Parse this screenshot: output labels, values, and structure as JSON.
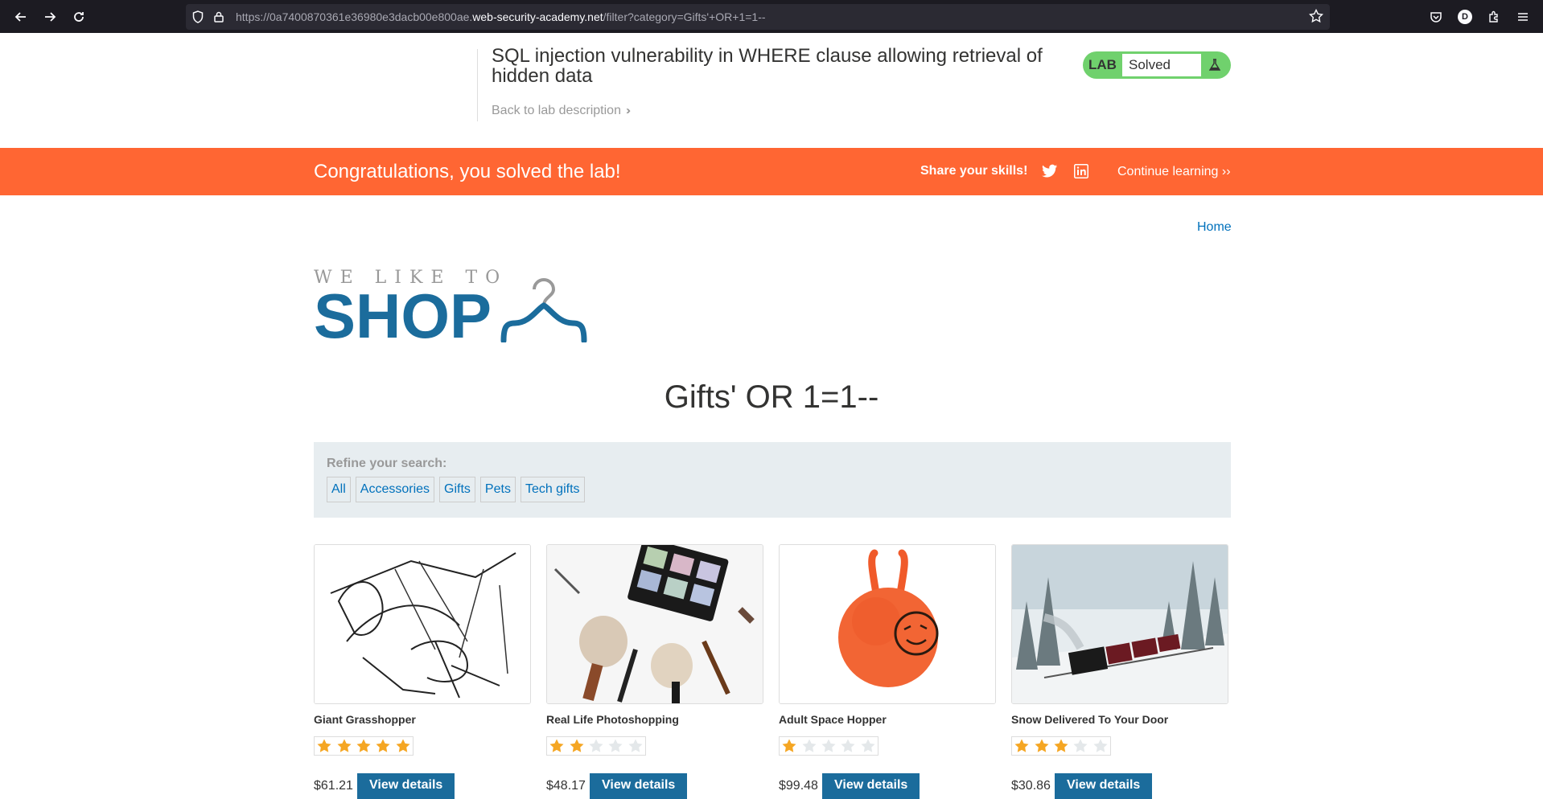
{
  "browser": {
    "url_prefix": "https://0a7400870361e36980e3dacb00e800ae.",
    "url_domain": "web-security-academy.net",
    "url_path": "/filter?category=Gifts'+OR+1=1--",
    "profile_initial": "D"
  },
  "lab": {
    "title": "SQL injection vulnerability in WHERE clause allowing retrieval of hidden data",
    "back_link": "Back to lab description",
    "badge_label": "LAB",
    "status": "Solved"
  },
  "banner": {
    "message": "Congratulations, you solved the lab!",
    "share": "Share your skills!",
    "continue": "Continue learning",
    "color": "#ff6633"
  },
  "nav": {
    "home": "Home"
  },
  "logo": {
    "line1": "WE LIKE TO",
    "line2": "SHOP"
  },
  "page": {
    "heading": "Gifts' OR 1=1--"
  },
  "refine": {
    "label": "Refine your search:",
    "filters": [
      "All",
      "Accessories",
      "Gifts",
      "Pets",
      "Tech gifts"
    ]
  },
  "products": [
    {
      "name": "Giant Grasshopper",
      "rating": 5,
      "price": "$61.21",
      "button": "View details"
    },
    {
      "name": "Real Life Photoshopping",
      "rating": 2,
      "price": "$48.17",
      "button": "View details"
    },
    {
      "name": "Adult Space Hopper",
      "rating": 1,
      "price": "$99.48",
      "button": "View details"
    },
    {
      "name": "Snow Delivered To Your Door",
      "rating": 3,
      "price": "$30.86",
      "button": "View details"
    }
  ]
}
